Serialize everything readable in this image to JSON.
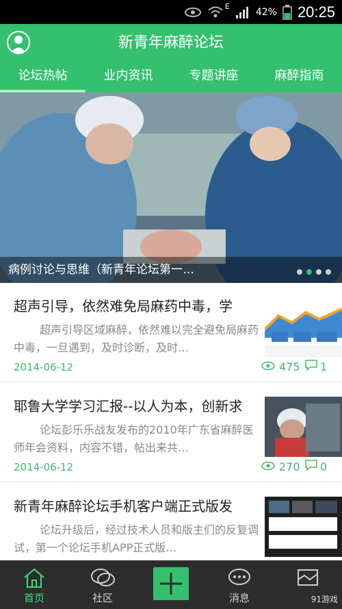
{
  "status_bar": {
    "time": "20:25",
    "battery_percent": "42%",
    "network_type": "E"
  },
  "header": {
    "title": "新青年麻醉论坛"
  },
  "tabs": [
    {
      "label": "论坛热帖"
    },
    {
      "label": "业内资讯"
    },
    {
      "label": "专题讲座"
    },
    {
      "label": "麻醉指南"
    }
  ],
  "banner": {
    "caption": "病例讨论与思维（新青年论坛第一…"
  },
  "posts": [
    {
      "title": "超声引导，依然难免局麻药中毒，学",
      "summary": "超声引导区域麻醉，依然难以完全避免局麻药中毒，一旦遇到，及时诊断，及时…",
      "date": "2014-06-12",
      "views": "475",
      "comments": "1"
    },
    {
      "title": "耶鲁大学学习汇报--以人为本，创新求",
      "summary": "论坛彭乐乐战友发布的2010年广东省麻醉医师年会资料，内容不错，帖出来共…",
      "date": "2014-06-12",
      "views": "270",
      "comments": "0"
    },
    {
      "title": "新青年麻醉论坛手机客户端正式版发",
      "summary": "论坛升级后，经过技术人员和版主们的反复调试，第一个论坛手机APP正式版…",
      "date": "",
      "views": "",
      "comments": ""
    }
  ],
  "bottom_nav": [
    {
      "label": "首页",
      "icon": "home-icon"
    },
    {
      "label": "社区",
      "icon": "chat-bubbles-icon"
    },
    {
      "label": "",
      "icon": "plus-icon"
    },
    {
      "label": "消息",
      "icon": "message-icon"
    },
    {
      "label": "",
      "icon": "map-icon"
    }
  ],
  "watermark": "91游戏",
  "colors": {
    "primary": "#34c06e",
    "nav_bg": "#2d2d2d",
    "accent_text": "#3fb96b"
  }
}
